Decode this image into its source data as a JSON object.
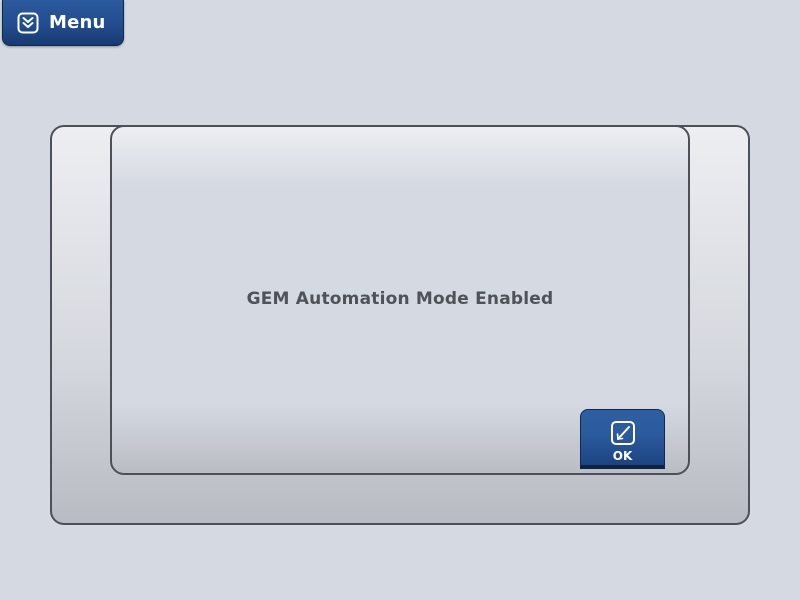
{
  "menu": {
    "label": "Menu",
    "icon": "double-chevron-down-icon"
  },
  "dialog": {
    "message": "GEM Automation Mode Enabled",
    "ok_button": {
      "label": "OK",
      "icon": "check-box-icon"
    }
  },
  "colors": {
    "background": "#d5dae2",
    "button_blue": "#224d8f",
    "border": "#4d5157",
    "message_text": "#4f5259"
  }
}
